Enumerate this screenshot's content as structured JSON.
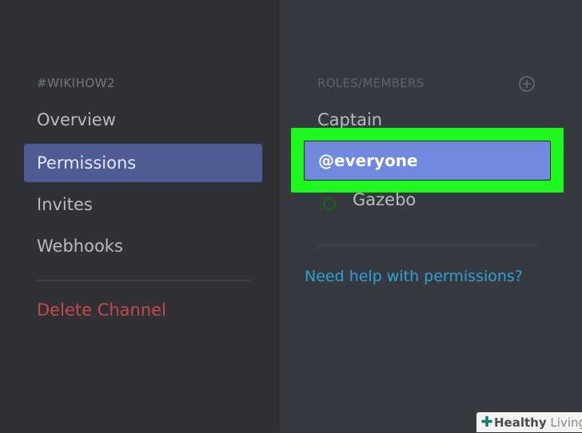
{
  "sidebar": {
    "channel_name": "#WIKIHOW2",
    "items": [
      {
        "label": "Overview"
      },
      {
        "label": "Permissions"
      },
      {
        "label": "Invites"
      },
      {
        "label": "Webhooks"
      }
    ],
    "delete_label": "Delete Channel"
  },
  "roles": {
    "header": "ROLES/MEMBERS",
    "add_icon": "plus-circle-icon",
    "items": [
      {
        "label": "Captain"
      },
      {
        "label": "@everyone"
      },
      {
        "label": "Gazebo"
      }
    ]
  },
  "help_link": "Need help with permissions?",
  "watermark": {
    "word1": "Healthy",
    "word2": "Living"
  },
  "colors": {
    "highlight": "#1ef81e",
    "selected_role": "#7089dc",
    "selected_nav": "#4f5b93",
    "delete": "#c7484a",
    "link": "#2ea2d8"
  }
}
